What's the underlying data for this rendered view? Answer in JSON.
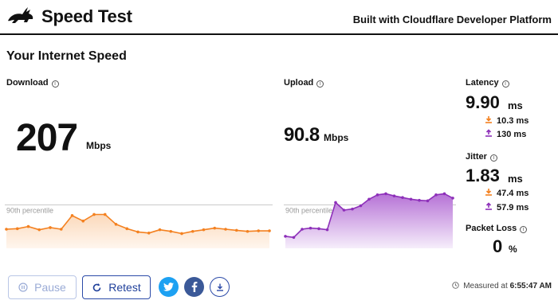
{
  "header": {
    "title": "Speed Test",
    "built_with": "Built with Cloudflare Developer Platform",
    "logo_icon": "rabbit-logo-icon"
  },
  "section_title": "Your Internet Speed",
  "download": {
    "label": "Download",
    "value": "207",
    "unit": "Mbps",
    "color": "#f48120",
    "percentile_label": "90th percentile"
  },
  "upload": {
    "label": "Upload",
    "value": "90.8",
    "unit": "Mbps",
    "color": "#8d2fb9",
    "percentile_label": "90th percentile"
  },
  "latency": {
    "label": "Latency",
    "value": "9.90",
    "unit": "ms",
    "down": "10.3 ms",
    "up": "130 ms"
  },
  "jitter": {
    "label": "Jitter",
    "value": "1.83",
    "unit": "ms",
    "down": "47.4 ms",
    "up": "57.9 ms"
  },
  "packet_loss": {
    "label": "Packet Loss",
    "value": "0",
    "unit": "%"
  },
  "buttons": {
    "pause": "Pause",
    "retest": "Retest"
  },
  "social": {
    "twitter_icon": "twitter-icon",
    "facebook_icon": "facebook-icon",
    "download_icon": "download-icon"
  },
  "measured": {
    "prefix": "Measured at",
    "time": "6:55:47 AM"
  },
  "colors": {
    "download_accent": "#f48120",
    "upload_accent": "#8d2fb9",
    "button_blue": "#2b4aa8",
    "twitter": "#1da1f2",
    "facebook": "#3b5998"
  },
  "chart_data": [
    {
      "type": "area",
      "series": [
        {
          "values": [
            35,
            36,
            40,
            34,
            38,
            35,
            60,
            50,
            62,
            62,
            44,
            36,
            30,
            28,
            34,
            31,
            27,
            31,
            34,
            37,
            35,
            33,
            31,
            32,
            32
          ]
        }
      ],
      "percentile_value": 100
    },
    {
      "type": "area",
      "series": [
        {
          "values": [
            22,
            20,
            35,
            37,
            36,
            34,
            84,
            70,
            72,
            78,
            90,
            98,
            100,
            96,
            93,
            90,
            88,
            87,
            98,
            100,
            92
          ]
        }
      ],
      "percentile_value": 100
    }
  ]
}
